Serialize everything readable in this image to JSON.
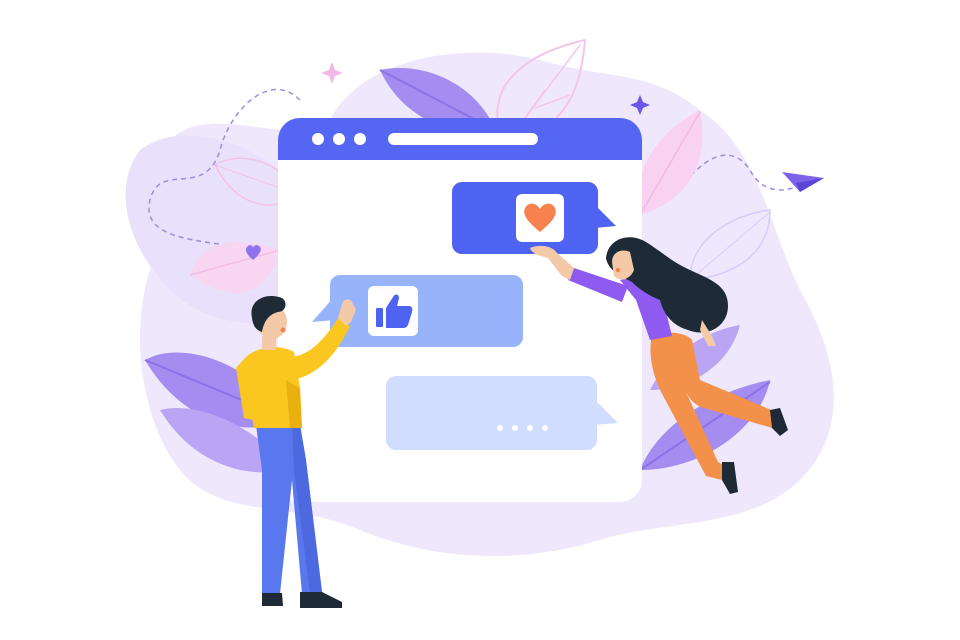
{
  "scene": {
    "type": "illustration",
    "icons": {
      "heart": "heart-icon",
      "thumbs_up": "thumbs-up-icon",
      "typing": "typing-dots-icon",
      "paper_plane": "paper-plane-icon",
      "sparkle": "sparkle-icon"
    },
    "colors": {
      "background_blob": "#EEE7FC",
      "browser_bar": "#5466F2",
      "browser_body": "#FFFFFF",
      "bubble_heart": "#4F63F3",
      "bubble_like": "#96B3FB",
      "bubble_typing": "#D1DDFE",
      "heart": "#F7814F",
      "man_shirt": "#F9C720",
      "man_pants": "#5A78EE",
      "woman_top": "#8F5AF0",
      "woman_pants": "#F3904A",
      "hair_dark": "#1E2A36",
      "leaf_purple": "#A58CF1",
      "leaf_pink": "#F6C9EC"
    }
  }
}
